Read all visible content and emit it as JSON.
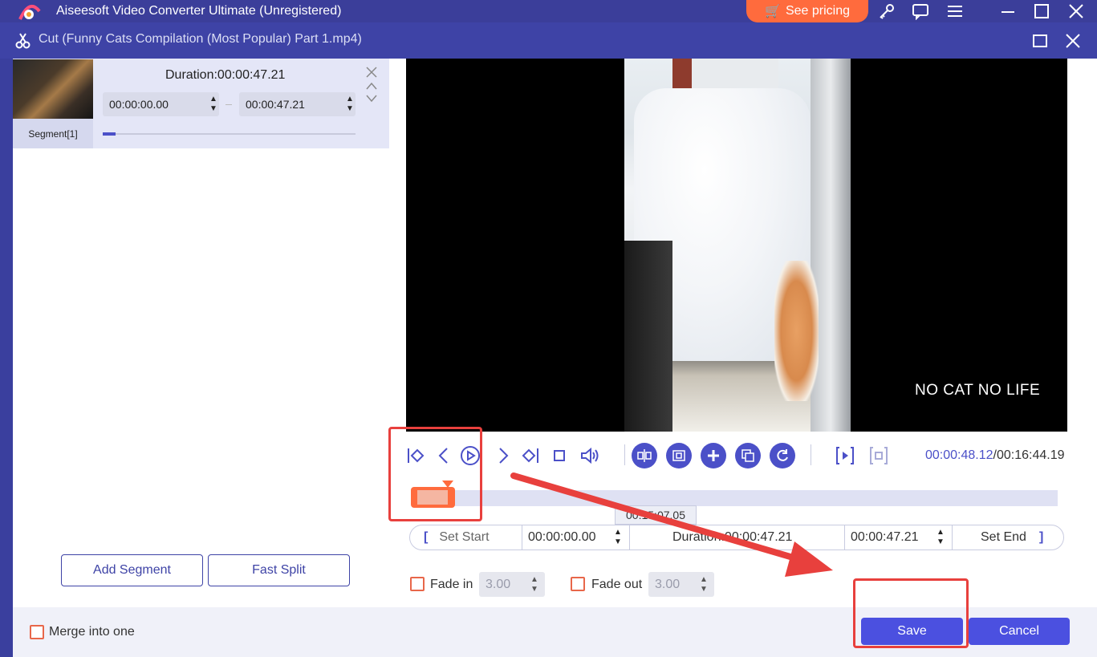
{
  "app": {
    "title": "Aiseesoft Video Converter Ultimate (Unregistered)",
    "pricing_label": "See pricing"
  },
  "dialog": {
    "title": "Cut (Funny Cats Compilation (Most Popular) Part 1.mp4)"
  },
  "segment": {
    "label": "Segment[1]",
    "duration_text": "Duration:00:00:47.21",
    "start": "00:00:00.00",
    "end": "00:00:47.21",
    "progress": 0.05
  },
  "buttons": {
    "add_segment": "Add Segment",
    "fast_split": "Fast Split",
    "merge_label": "Merge into one",
    "save": "Save",
    "cancel": "Cancel"
  },
  "video": {
    "watermark": "NO CAT NO LIFE"
  },
  "player": {
    "current_time": "00:00:48.12",
    "total_time": "/00:16:44.19",
    "tooltip_time": "00:15:07.05"
  },
  "setbar": {
    "set_start": "Set Start",
    "start_value": "00:00:00.00",
    "duration_text": "Duration:00:00:47.21",
    "end_value": "00:00:47.21",
    "set_end": "Set End"
  },
  "fade": {
    "fade_in_label": "Fade in",
    "fade_in_value": "3.00",
    "fade_out_label": "Fade out",
    "fade_out_value": "3.00"
  },
  "colors": {
    "accent": "#4b50c8",
    "orange": "#ff6b3d",
    "highlight": "#e8403d"
  }
}
